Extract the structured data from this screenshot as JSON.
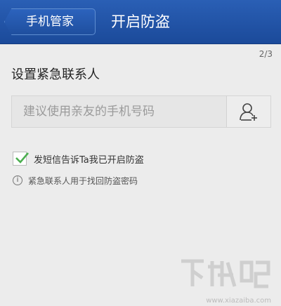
{
  "header": {
    "back_label": "手机管家",
    "title": "开启防盗"
  },
  "step": "2/3",
  "section": {
    "title": "设置紧急联系人"
  },
  "phone_input": {
    "placeholder": "建议使用亲友的手机号码",
    "value": ""
  },
  "sms_option": {
    "label": "发短信告诉Ta我已开启防盗",
    "checked": true
  },
  "note": {
    "text": "紧急联系人用于找回防盗密码"
  },
  "watermark": {
    "text": "下载吧",
    "url_text": "www.xiazaiba.com"
  },
  "colors": {
    "header_bg": "#1b4a9a",
    "background": "#ececec",
    "check": "#4caf50"
  }
}
